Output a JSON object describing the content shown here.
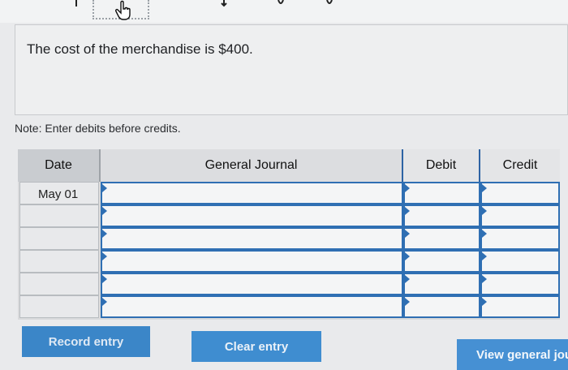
{
  "question": {
    "text": "The cost of the merchandise is $400."
  },
  "note": {
    "text": "Note: Enter debits before credits."
  },
  "journal": {
    "headers": {
      "date": "Date",
      "general_journal": "General Journal",
      "debit": "Debit",
      "credit": "Credit"
    },
    "rows": [
      {
        "date": "May 01",
        "account": "",
        "debit": "",
        "credit": ""
      },
      {
        "date": "",
        "account": "",
        "debit": "",
        "credit": ""
      },
      {
        "date": "",
        "account": "",
        "debit": "",
        "credit": ""
      },
      {
        "date": "",
        "account": "",
        "debit": "",
        "credit": ""
      },
      {
        "date": "",
        "account": "",
        "debit": "",
        "credit": ""
      },
      {
        "date": "",
        "account": "",
        "debit": "",
        "credit": ""
      }
    ]
  },
  "buttons": {
    "record_entry": "Record entry",
    "clear_entry": "Clear entry",
    "view_general_journal": "View general jou"
  },
  "colors": {
    "accent": "#2f6fb3",
    "button": "#3b86c8"
  },
  "icons": {
    "cursor": "hand-pointer-icon"
  }
}
